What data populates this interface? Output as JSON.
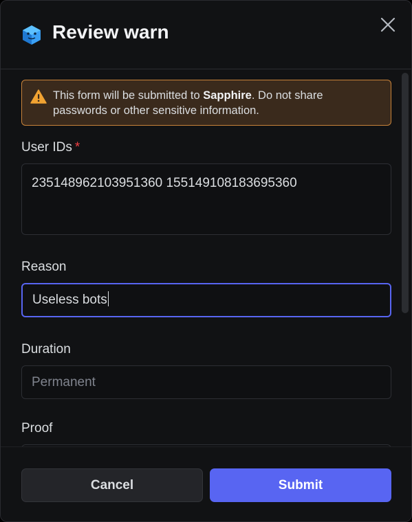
{
  "dialog": {
    "title": "Review warn",
    "app_icon": "cube-bot-icon",
    "close_icon": "close-icon"
  },
  "notice": {
    "icon": "warning-triangle-icon",
    "text_before": "This form will be submitted to ",
    "app_name": "Sapphire",
    "text_after": ". Do not share passwords or other sensitive information."
  },
  "fields": {
    "user_ids": {
      "label": "User IDs",
      "required_marker": "*",
      "value": "235148962103951360 155149108183695360"
    },
    "reason": {
      "label": "Reason",
      "value": "Useless bots"
    },
    "duration": {
      "label": "Duration",
      "placeholder": "Permanent"
    },
    "proof": {
      "label": "Proof"
    }
  },
  "footer": {
    "cancel_label": "Cancel",
    "submit_label": "Submit"
  },
  "colors": {
    "accent": "#5865f2",
    "warning_border": "#c9843a",
    "warning_bg": "#3a2a1c",
    "required": "#f23f43",
    "background": "#111214"
  }
}
